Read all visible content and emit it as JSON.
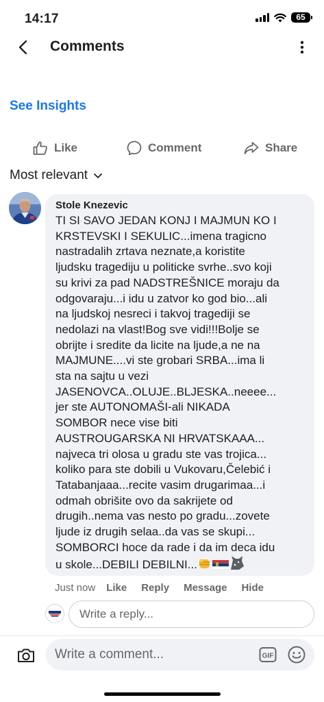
{
  "status_bar": {
    "time": "14:17",
    "battery": "65"
  },
  "header": {
    "title": "Comments"
  },
  "insights_label": "See Insights",
  "actions": {
    "like": "Like",
    "comment": "Comment",
    "share": "Share"
  },
  "sort_label": "Most relevant",
  "comment": {
    "author": "Stole Knezevic",
    "text": "TI SI SAVO JEDAN KONJ I MAJMUN KO I\nKRSTEVSKI I SEKULIC...imena tragicno\nnastradalih zrtava neznate,a koristite\nljudsku tragediju u politicke svrhe..svo koji\nsu krivi za pad NADSTREŠNICE moraju da\nodgovaraju...i idu u zatvor ko god bio...ali\nna ljudskoj nesreci i takvoj tragediji se\nnedolazi na vlast!Bog sve vidi!!!Bolje se\nobrijte i sredite da licite na ljude,a ne na\nMAJMUNE....vi ste grobari SRBA...ima li\nsta na sajtu u vezi\nJASENOVCA..OLUJE..BLJESKA..neeee...\njer ste AUTONOMAŠI-ali NIKADA\nSOMBOR nece vise biti\nAUSTROUGARSKA NI HRVATSKAAA...\nnajveca tri olosa u gradu ste vas trojica...\nkoliko para ste dobili u Vukovaru,Čelebić i\nTatabanjaaa...recite vasim drugarimaa...i\nodmah obrišite ovo da sakrijete od\ndrugih..nema vas nesto po gradu...zovete\nljude iz drugih selaa..da vas se skupi...\nSOMBORCI hoce da rade i da im deca idu\nu skole...DEBILI DEBILNI...",
    "emojis": {
      "fist": "fist-emoji",
      "flag": "serbian-flag-emoji",
      "wolf": "wolf-emoji"
    },
    "time": "Just now",
    "like_label": "Like",
    "reply_label": "Reply",
    "message_label": "Message",
    "hide_label": "Hide"
  },
  "reply_placeholder": "Write a reply...",
  "comment_placeholder": "Write a comment...",
  "gif_label": "GIF",
  "colors": {
    "accent": "#1877f2",
    "secondary_text": "#65676b",
    "bubble": "#f0f2f5"
  }
}
